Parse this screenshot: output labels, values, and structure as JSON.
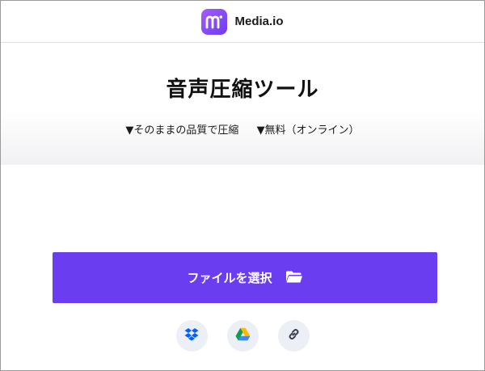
{
  "header": {
    "brand_name": "Media.io",
    "logo_icon": "media-io-logo-icon"
  },
  "hero": {
    "title": "音声圧縮ツール",
    "features": [
      "▼そのままの品質で圧縮",
      "▼無料（オンライン）"
    ]
  },
  "upload": {
    "button_label": "ファイルを選択",
    "button_icon": "folder-icon",
    "sources": [
      {
        "icon": "dropbox-icon"
      },
      {
        "icon": "google-drive-icon"
      },
      {
        "icon": "link-icon"
      }
    ]
  },
  "colors": {
    "accent": "#6a3df0",
    "logo_gradient_start": "#a55cff",
    "logo_gradient_end": "#6a3cf0",
    "source_button_bg": "#eceff6",
    "dropbox": "#0061fe",
    "link_icon": "#3a3f57"
  }
}
